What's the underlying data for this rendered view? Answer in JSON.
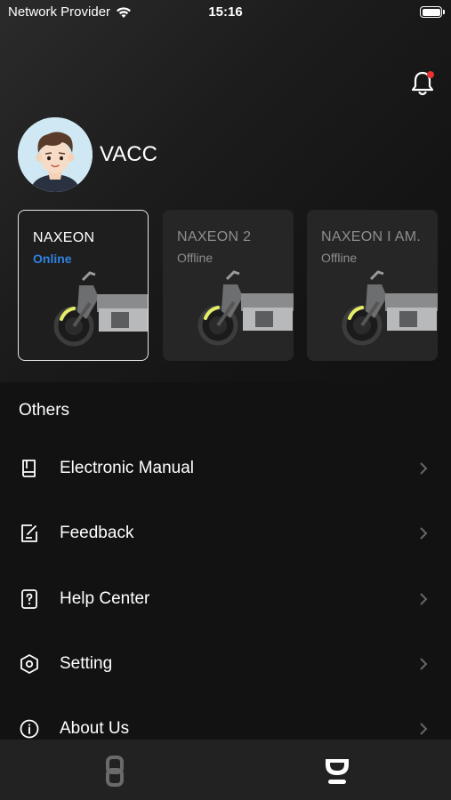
{
  "status_bar": {
    "carrier": "Network Provider",
    "time": "15:16"
  },
  "header": {
    "notification_icon": "bell-icon",
    "has_unread": true
  },
  "profile": {
    "username": "VACC"
  },
  "vehicles": [
    {
      "name": "NAXEON",
      "status": "Online",
      "selected": true
    },
    {
      "name": "NAXEON 2",
      "status": "Offline",
      "selected": false
    },
    {
      "name": "NAXEON I AM.",
      "status": "Offline",
      "selected": false
    }
  ],
  "others": {
    "title": "Others",
    "items": [
      {
        "label": "Electronic Manual",
        "icon": "book-icon"
      },
      {
        "label": "Feedback",
        "icon": "edit-note-icon"
      },
      {
        "label": "Help Center",
        "icon": "question-doc-icon"
      },
      {
        "label": "Setting",
        "icon": "hexagon-gear-icon"
      },
      {
        "label": "About Us",
        "icon": "info-circle-icon"
      }
    ]
  },
  "tab_bar": {
    "tabs": [
      {
        "icon": "vehicle-link-icon"
      },
      {
        "icon": "profile-icon",
        "active": true
      }
    ]
  },
  "colors": {
    "background": "#121212",
    "online": "#2f82e0",
    "badge": "#e8322f",
    "tab_bar": "#222222"
  }
}
